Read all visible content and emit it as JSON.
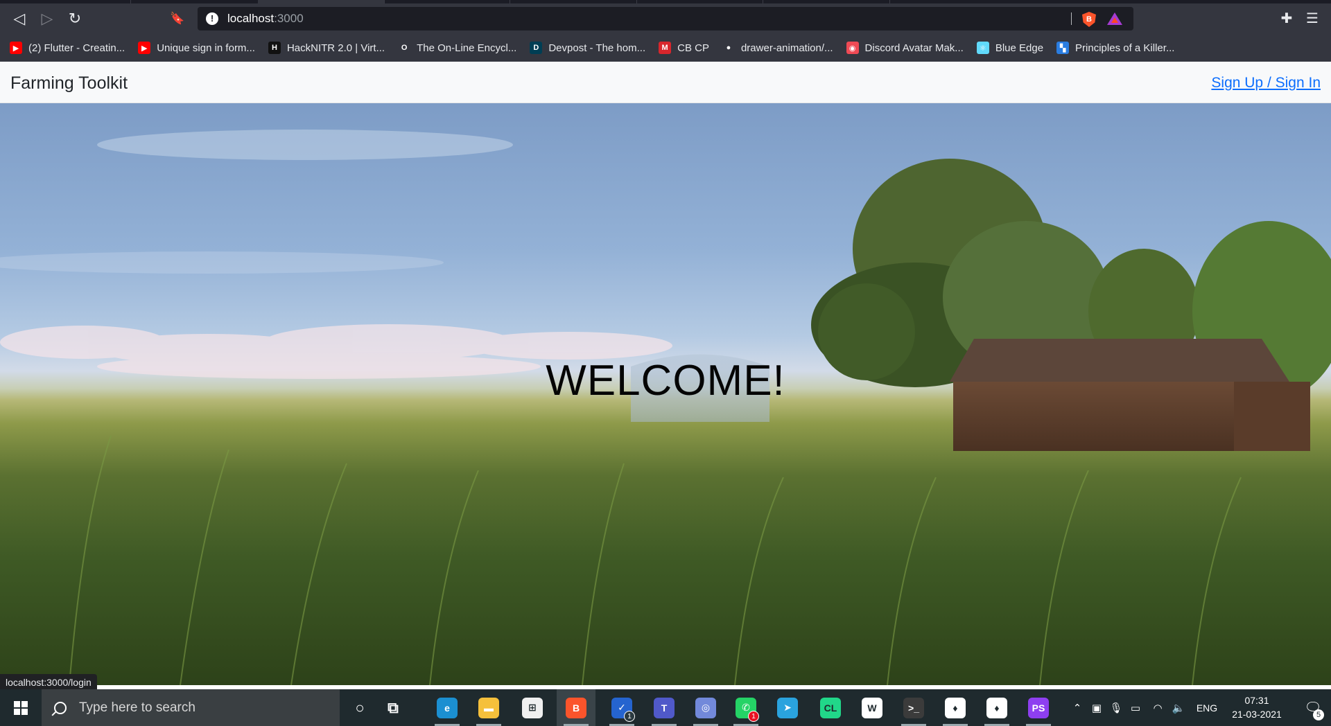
{
  "browser": {
    "url_host": "localhost",
    "url_port": ":3000",
    "back_glyph": "◁",
    "forward_glyph": "▷",
    "reload_glyph": "↻",
    "bookmark_glyph": "🔖",
    "info_glyph": "!",
    "shield_glyph": "B",
    "extensions_glyph": "✚",
    "menu_glyph": "☰"
  },
  "bookmarks": [
    {
      "label": "(2) Flutter - Creatin...",
      "icon": "youtube-icon",
      "glyph": "▶",
      "color": "#ff0000"
    },
    {
      "label": "Unique sign in form...",
      "icon": "youtube-icon",
      "glyph": "▶",
      "color": "#ff0000"
    },
    {
      "label": "HackNITR 2.0 | Virt...",
      "icon": "hacknitr-icon",
      "glyph": "H",
      "color": "#111111"
    },
    {
      "label": "The On-Line Encycl...",
      "icon": "oeis-icon",
      "glyph": "O",
      "color": "#ffffff"
    },
    {
      "label": "Devpost - The hom...",
      "icon": "devpost-icon",
      "glyph": "D",
      "color": "#003e54"
    },
    {
      "label": "CB CP",
      "icon": "codebook-icon",
      "glyph": "M",
      "color": "#d8262c"
    },
    {
      "label": "drawer-animation/...",
      "icon": "github-icon",
      "glyph": "●",
      "color": "#ffffff"
    },
    {
      "label": "Discord Avatar Mak...",
      "icon": "discord-icon",
      "glyph": "◉",
      "color": "#ef4a55"
    },
    {
      "label": "Blue Edge",
      "icon": "react-icon",
      "glyph": "⚛",
      "color": "#61dafb"
    },
    {
      "label": "Principles of a Killer...",
      "icon": "blocks-icon",
      "glyph": "▚",
      "color": "#2a7de1"
    }
  ],
  "navbar": {
    "brand": "Farming Toolkit",
    "signin": "Sign Up / Sign In"
  },
  "hero": {
    "heading": "WELCOME!"
  },
  "status_bar": {
    "link_preview": "localhost:3000/login"
  },
  "taskbar": {
    "search_placeholder": "Type here to search",
    "apps": [
      {
        "name": "cortana",
        "glyph": "○",
        "color": "transparent"
      },
      {
        "name": "task-view",
        "glyph": "⧉",
        "color": "transparent"
      },
      {
        "name": "edge",
        "glyph": "e",
        "color": "#1b8fd1"
      },
      {
        "name": "file-explorer",
        "glyph": "▬",
        "color": "#f5c03b"
      },
      {
        "name": "store",
        "glyph": "⊞",
        "color": "#f0f0f0"
      },
      {
        "name": "brave",
        "glyph": "B",
        "color": "#fb542b"
      },
      {
        "name": "todo",
        "glyph": "✓",
        "color": "#2564cf",
        "badge": "1"
      },
      {
        "name": "teams",
        "glyph": "T",
        "color": "#5059c9"
      },
      {
        "name": "discord",
        "glyph": "◎",
        "color": "#7289da"
      },
      {
        "name": "whatsapp",
        "glyph": "✆",
        "color": "#25d366",
        "badge": "1"
      },
      {
        "name": "telegram",
        "glyph": "➤",
        "color": "#2aa3de"
      },
      {
        "name": "clion",
        "glyph": "CL",
        "color": "#21d789"
      },
      {
        "name": "word-app",
        "glyph": "W",
        "color": "#ffffff"
      },
      {
        "name": "terminal",
        "glyph": ">_",
        "color": "#3b3b3b"
      },
      {
        "name": "mongodb-compass",
        "glyph": "♦",
        "color": "#ffffff"
      },
      {
        "name": "mongodb-shell",
        "glyph": "♦",
        "color": "#ffffff"
      },
      {
        "name": "phpstorm",
        "glyph": "PS",
        "color": "#8e3ff0"
      }
    ],
    "tray_icons": [
      {
        "name": "chevron-up-icon",
        "glyph": "⌃"
      },
      {
        "name": "meet-now-icon",
        "glyph": "▣"
      },
      {
        "name": "microphone-icon",
        "glyph": "🎙"
      },
      {
        "name": "battery-icon",
        "glyph": "▭"
      },
      {
        "name": "wifi-icon",
        "glyph": "◠"
      },
      {
        "name": "volume-icon",
        "glyph": "🔈"
      }
    ],
    "language": "ENG",
    "time": "07:31",
    "date": "21-03-2021",
    "notification_glyph": "🗨",
    "notification_count": "5"
  }
}
